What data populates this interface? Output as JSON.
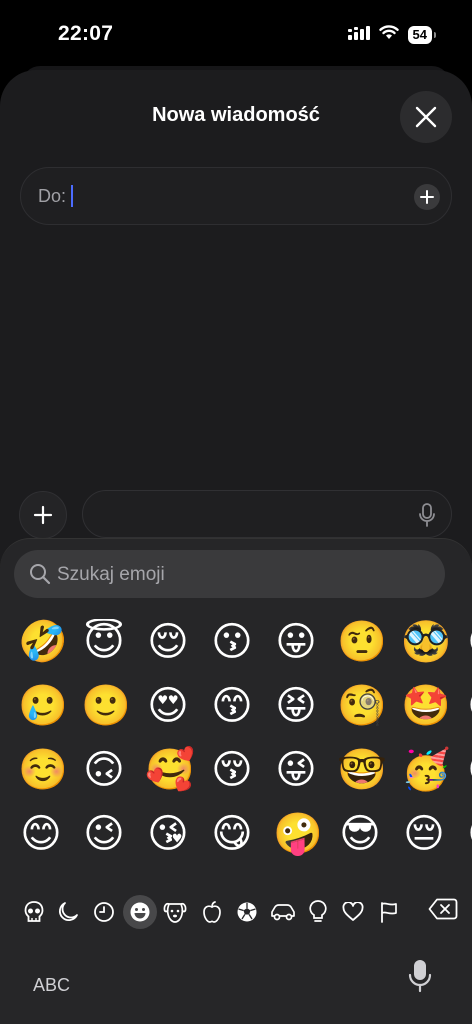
{
  "status_bar": {
    "time": "22:07",
    "battery": "54"
  },
  "sheet": {
    "title": "Nowa wiadomość"
  },
  "to_field": {
    "label": "Do:"
  },
  "emoji_search": {
    "placeholder": "Szukaj emoji"
  },
  "emoji_rows": [
    [
      "🤣",
      "😇",
      "😌",
      "😗",
      "😛",
      "🤨",
      "🥸",
      "😋"
    ],
    [
      "🥲",
      "🙂",
      "😍",
      "😙",
      "😝",
      "🧐",
      "🤩",
      "😋"
    ],
    [
      "☺️",
      "🙃",
      "🥰",
      "😚",
      "😜",
      "🤓",
      "🥳",
      "😏"
    ],
    [
      "😊",
      "😉",
      "😘",
      "😋",
      "🤪",
      "😎",
      "😔",
      "😟"
    ]
  ],
  "categories": [
    {
      "name": "skull-category",
      "icon": "skull-icon"
    },
    {
      "name": "moon-category",
      "icon": "moon-icon"
    },
    {
      "name": "recent-category",
      "icon": "clock-icon"
    },
    {
      "name": "smileys-category",
      "icon": "smiley-icon",
      "selected": true
    },
    {
      "name": "animals-category",
      "icon": "dog-icon"
    },
    {
      "name": "food-category",
      "icon": "apple-icon"
    },
    {
      "name": "activity-category",
      "icon": "ball-icon"
    },
    {
      "name": "travel-category",
      "icon": "car-icon"
    },
    {
      "name": "objects-category",
      "icon": "bulb-icon"
    },
    {
      "name": "symbols-category",
      "icon": "heart-icon"
    },
    {
      "name": "flags-category",
      "icon": "flag-icon"
    }
  ],
  "keyboard": {
    "abc_label": "ABC"
  }
}
